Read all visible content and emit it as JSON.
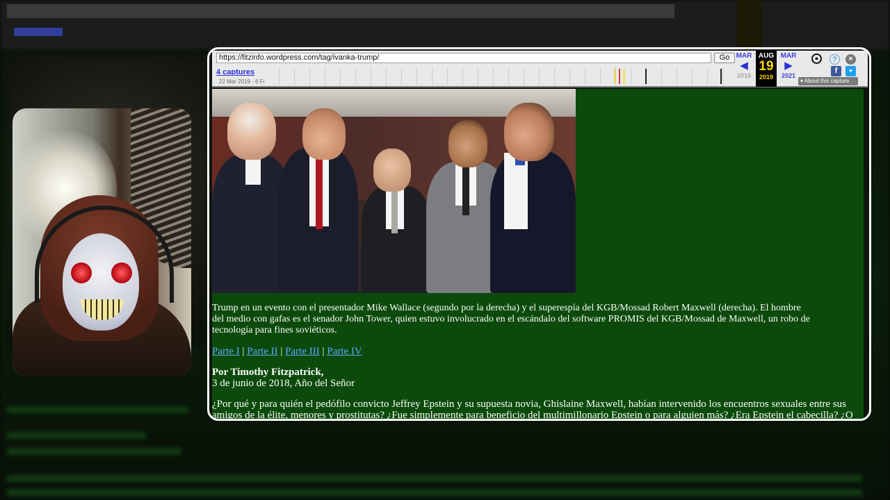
{
  "wayback": {
    "url": "https://fitzinfo.wordpress.com/tag/ivanka-trump/",
    "go_label": "Go",
    "captures_label": "4 captures",
    "date_range": "22 Mar 2019 - 6 Fe",
    "prev_month": "MAR",
    "prev_year": "2018",
    "cur_month": "AUG",
    "cur_day": "19",
    "cur_year": "2019",
    "next_month": "MAR",
    "next_year": "2021",
    "about_label": "About this capture",
    "icons": [
      "user-icon",
      "help-icon",
      "close-icon",
      "facebook-icon",
      "twitter-icon"
    ]
  },
  "article": {
    "caption": "Trump en un evento con el presentador Mike Wallace (segundo por la derecha) y el superespía del KGB/Mossad Robert Maxwell (derecha). El hombre del medio con gafas es el senador John Tower, quien estuvo involucrado en el escándalo del software PROMIS del KGB/Mossad de Maxwell, un robo de tecnología para fines soviéticos.",
    "parts": [
      "Parte I",
      "Parte II",
      "Parte III",
      "Parte IV"
    ],
    "parts_sep": "|",
    "author": "Por Timothy Fitzpatrick,",
    "date": "3 de junio de 2018, Año del Señor",
    "paragraph": "¿Por qué y para quién el pedófilo convicto Jeffrey Epstein y su supuesta novia, Ghislaine Maxwell, habían intervenido los encuentros sexuales entre sus amigos de la élite, menores y prostitutas? ¿Fue simplemente para beneficio del multimillonario Epstein o para alguien más? ¿Era Epstein el cabecilla? ¿O en realidad era su novia?"
  },
  "colors": {
    "page_bg": "#0b4a0b",
    "link": "#5ea8ff",
    "wayback_highlight": "#ffd800",
    "wayback_nav": "#3c42d8"
  }
}
